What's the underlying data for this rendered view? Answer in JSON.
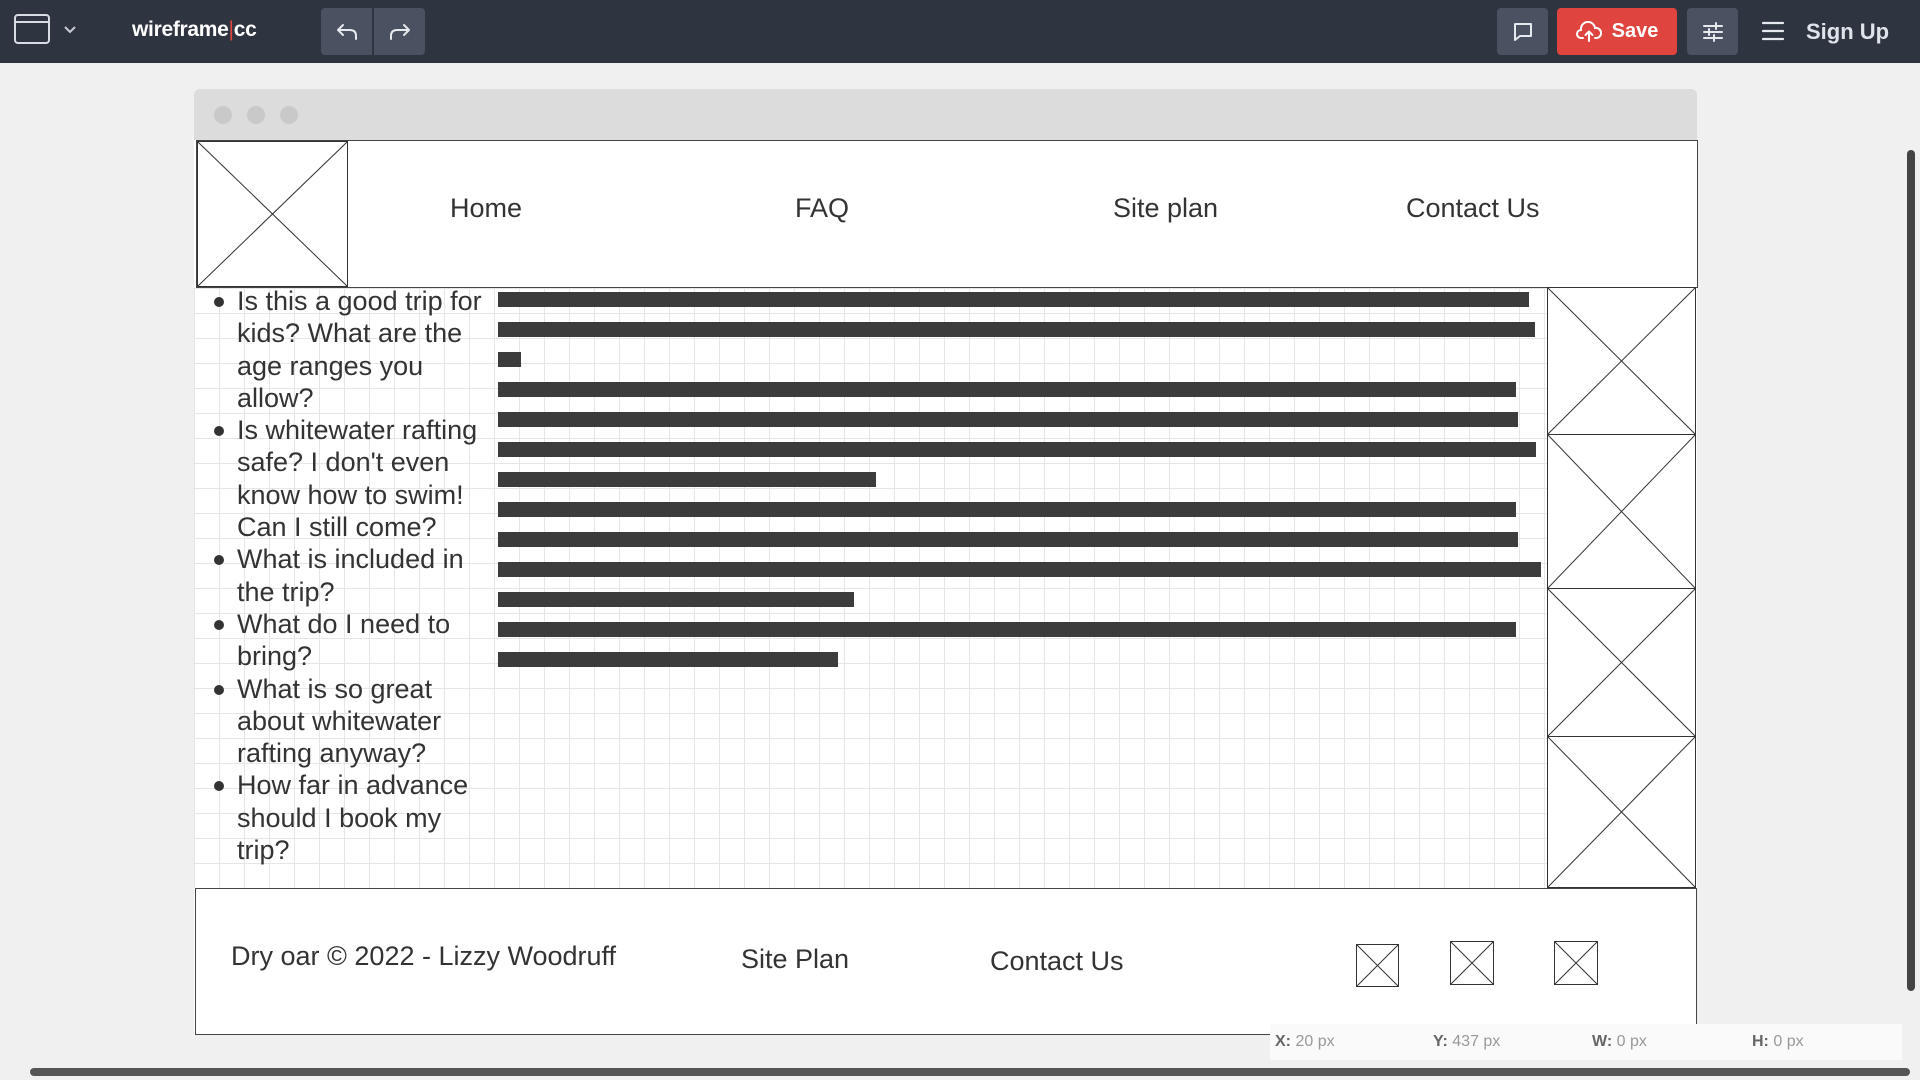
{
  "toolbar": {
    "brand_left": "wireframe",
    "brand_sep": "|",
    "brand_right": "cc",
    "save_label": "Save",
    "signup_label": "Sign Up"
  },
  "nav": [
    "Home",
    "FAQ",
    "Site plan",
    "Contact Us"
  ],
  "faq_items": [
    "Is this a good trip for kids? What are the age ranges you allow?",
    "Is whitewater rafting safe? I don't even know how to swim! Can I still come?",
    "What is included in the trip?",
    "What do I need to bring?",
    "What is so great about whitewater rafting anyway?",
    "How far in advance should I book my trip?"
  ],
  "footer": {
    "copyright": "Dry oar © 2022 - Lizzy Woodruff",
    "site_plan": "Site Plan",
    "contact": "Contact Us"
  },
  "status": {
    "x_label": "X:",
    "x_value": "20 px",
    "y_label": "Y:",
    "y_value": "437 px",
    "w_label": "W:",
    "w_value": "0 px",
    "h_label": "H:",
    "h_value": "0 px"
  },
  "icons": {
    "window": "window-icon",
    "undo": "undo-icon",
    "redo": "redo-icon",
    "comment": "comment-icon",
    "save": "cloud-upload-icon",
    "settings": "sliders-icon",
    "menu": "hamburger-menu-icon"
  },
  "colors": {
    "toolbar_bg": "#2e3440",
    "save_bg": "#e0443e",
    "button_bg": "#4a5160",
    "text_block": "#3c3c3c"
  }
}
